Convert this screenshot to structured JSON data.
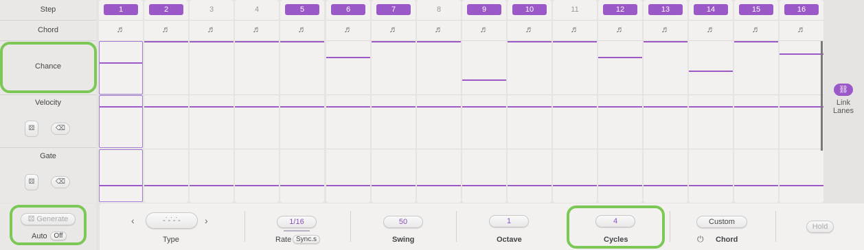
{
  "rows": {
    "step": "Step",
    "chord": "Chord",
    "chance": "Chance",
    "velocity": "Velocity",
    "gate": "Gate"
  },
  "steps": [
    {
      "label": "1",
      "active": true
    },
    {
      "label": "2",
      "active": true
    },
    {
      "label": "3",
      "active": false
    },
    {
      "label": "4",
      "active": false
    },
    {
      "label": "5",
      "active": true
    },
    {
      "label": "6",
      "active": true
    },
    {
      "label": "7",
      "active": true
    },
    {
      "label": "8",
      "active": false
    },
    {
      "label": "9",
      "active": true
    },
    {
      "label": "10",
      "active": true
    },
    {
      "label": "11",
      "active": false
    },
    {
      "label": "12",
      "active": true
    },
    {
      "label": "13",
      "active": true
    },
    {
      "label": "14",
      "active": true
    },
    {
      "label": "15",
      "active": true
    },
    {
      "label": "16",
      "active": true
    }
  ],
  "chance_levels": [
    0.6,
    1,
    1,
    1,
    1,
    0.7,
    1,
    1,
    0.27,
    1,
    1,
    0.7,
    1,
    0.44,
    1,
    0.77
  ],
  "icons": {
    "chord": "music-note-icon",
    "dice": "dice-icon",
    "eraser": "eraser-icon",
    "link": "link-icon",
    "power": "power-icon",
    "prev": "chevron-left-icon",
    "next": "chevron-right-icon"
  },
  "link_lanes": {
    "line1": "Link",
    "line2": "Lanes"
  },
  "generate": {
    "label": "Generate",
    "auto_label": "Auto",
    "auto_value": "Off"
  },
  "type": {
    "label": "Type"
  },
  "rate": {
    "value": "1/16",
    "label": "Rate",
    "sync": "Sync.s"
  },
  "swing": {
    "value": "50",
    "label": "Swing"
  },
  "octave": {
    "value": "1",
    "label": "Octave"
  },
  "cycles": {
    "value": "4",
    "label": "Cycles"
  },
  "chord_mode": {
    "value": "Custom",
    "label": "Chord"
  },
  "hold": {
    "label": "Hold"
  },
  "colors": {
    "accent": "#9b59c8",
    "highlight": "#7cc856",
    "panel": "#f2f1f0",
    "background": "#e5e4e3"
  }
}
